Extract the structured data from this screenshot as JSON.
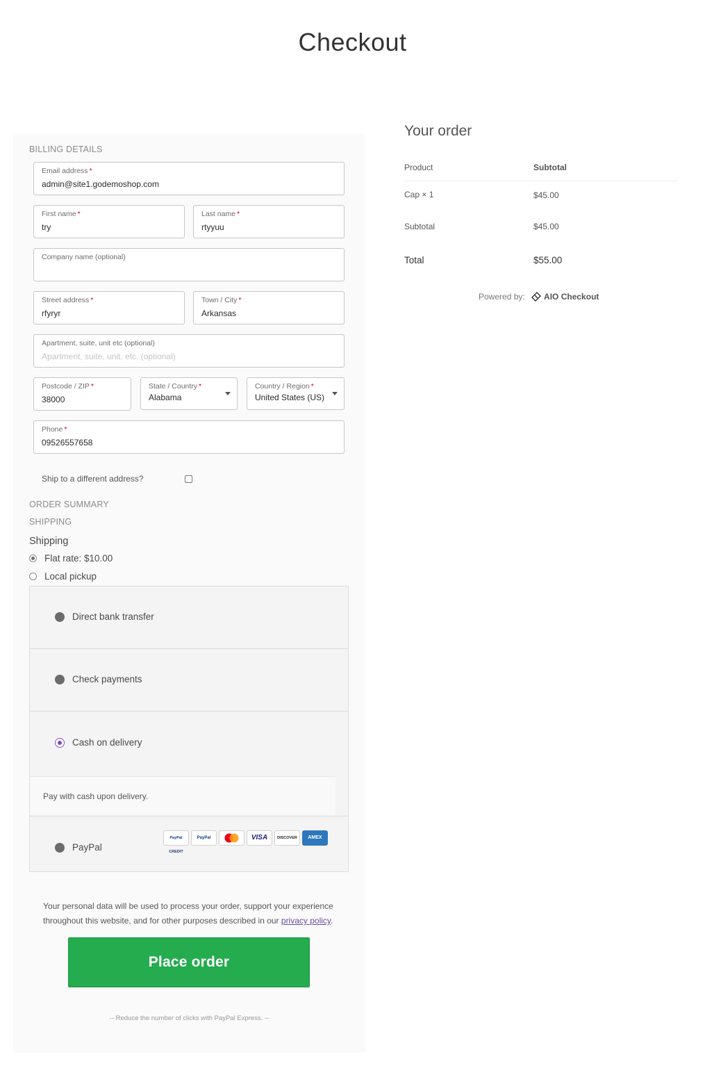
{
  "page": {
    "title": "Checkout"
  },
  "billing": {
    "section_label": "BILLING DETAILS",
    "required_marker": "*",
    "fields": {
      "email": {
        "label": "Email address",
        "value": "admin@site1.godemoshop.com",
        "required": true
      },
      "first_name": {
        "label": "First name",
        "value": "try",
        "required": true
      },
      "last_name": {
        "label": "Last name",
        "value": "rtyyuu",
        "required": true
      },
      "company": {
        "label": "Company name (optional)",
        "value": ""
      },
      "street": {
        "label": "Street address",
        "value": "rfyryr",
        "required": true
      },
      "city": {
        "label": "Town / City",
        "value": "Arkansas",
        "required": true
      },
      "apartment": {
        "label": "Apartment, suite, unit etc (optional)",
        "placeholder": "Apartment, suite, unit, etc. (optional)"
      },
      "postcode": {
        "label": "Postcode / ZIP",
        "value": "38000",
        "required": true
      },
      "state": {
        "label": "State / Country",
        "value": "Alabama",
        "required": true
      },
      "country": {
        "label": "Country / Region",
        "value": "United States (US)",
        "required": true
      },
      "phone": {
        "label": "Phone",
        "value": "09526557658",
        "required": true
      }
    },
    "ship_different": {
      "label": "Ship to a different address?",
      "checked": false
    }
  },
  "summary": {
    "order_summary_label": "ORDER SUMMARY",
    "shipping_label": "SHIPPING",
    "shipping_title": "Shipping",
    "shipping_options": [
      {
        "label": "Flat rate: $10.00",
        "selected": true
      },
      {
        "label": "Local pickup",
        "selected": false
      }
    ]
  },
  "payment": {
    "methods": [
      {
        "label": "Direct bank transfer",
        "selected": false
      },
      {
        "label": "Check payments",
        "selected": false
      },
      {
        "label": "Cash on delivery",
        "selected": true,
        "description": "Pay with cash upon delivery."
      },
      {
        "label": "PayPal",
        "selected": false
      }
    ],
    "card_icons": [
      "paypal-credit-icon",
      "paypal-icon",
      "mastercard-icon",
      "visa-icon",
      "discover-icon",
      "amex-icon"
    ],
    "card_labels": {
      "paypal_credit": "PayPal CREDIT",
      "paypal": "PayPal",
      "visa": "VISA",
      "discover": "DISCOVER",
      "amex": "AMEX"
    },
    "privacy_text": "Your personal data will be used to process your order, support your experience throughout this website, and for other purposes described in our",
    "privacy_link": "privacy policy",
    "privacy_end": ".",
    "place_order_label": "Place order",
    "express_note": "-- Reduce the number of clicks with PayPal Express. --"
  },
  "order": {
    "title": "Your order",
    "headers": {
      "product": "Product",
      "subtotal": "Subtotal"
    },
    "items": [
      {
        "name": "Cap × 1",
        "price": "$45.00"
      }
    ],
    "subtotal": {
      "label": "Subtotal",
      "value": "$45.00"
    },
    "total": {
      "label": "Total",
      "value": "$55.00"
    },
    "powered_by": {
      "label": "Powered by:",
      "brand": "AIO Checkout"
    }
  },
  "colors": {
    "accent_purple": "#7f4bbf",
    "place_order_green": "#24ac4e",
    "required_red": "#d0021b"
  }
}
